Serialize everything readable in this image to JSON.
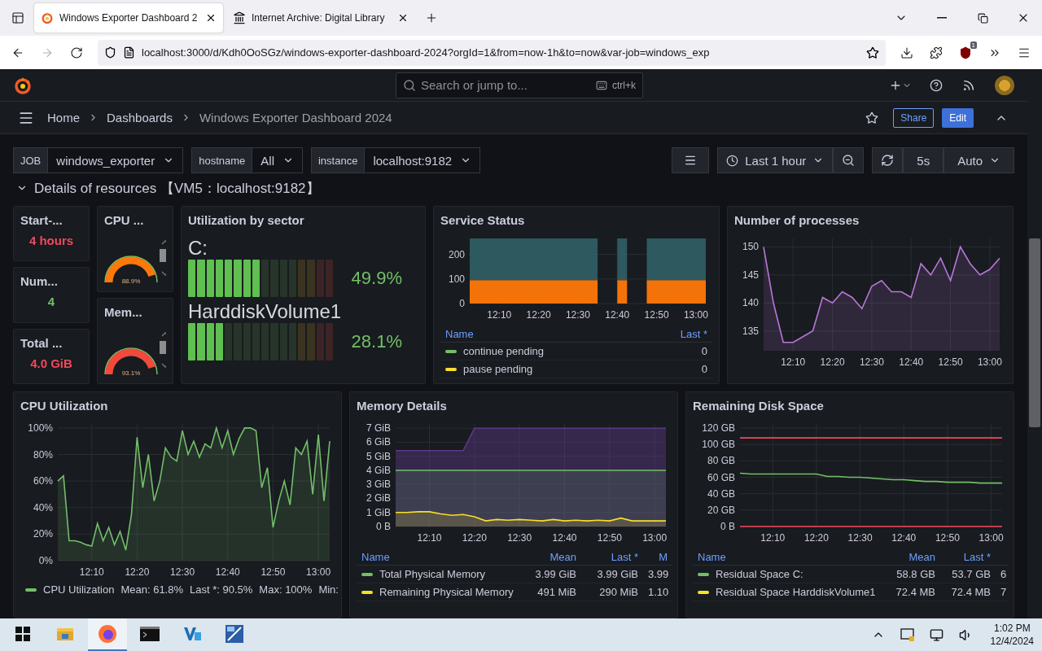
{
  "browser": {
    "tabs": [
      {
        "title": "Windows Exporter Dashboard 2",
        "kind": "grafana",
        "selected": true
      },
      {
        "title": "Internet Archive: Digital Library",
        "kind": "archive",
        "selected": false
      }
    ],
    "forward_enabled": false,
    "url": "localhost:3000/d/Kdh0OoSGz/windows-exporter-dashboard-2024?orgId=1&from=now-1h&to=now&var-job=windows_exp",
    "extension_badge": "1"
  },
  "grafana": {
    "search": {
      "placeholder": "Search or jump to...",
      "shortcut": "ctrl+k"
    },
    "breadcrumbs": [
      "Home",
      "Dashboards",
      "Windows Exporter Dashboard 2024"
    ],
    "share": "Share",
    "edit": "Edit",
    "variables": [
      {
        "label": "JOB",
        "value": "windows_exporter"
      },
      {
        "label": "hostname",
        "value": "All"
      },
      {
        "label": "instance",
        "value": "localhost:9182"
      }
    ],
    "time_range": "Last 1 hour",
    "refresh_interval": "5s",
    "refresh_mode": "Auto",
    "row": {
      "title": "Details of resources 【VM5：localhost:9182】",
      "expanded": true
    }
  },
  "stats": [
    {
      "title": "Start-...",
      "value": "4 hours",
      "color": "#f2495c"
    },
    {
      "title": "Num...",
      "value": "4",
      "color": "#73bf69"
    },
    {
      "title": "Total ...",
      "value": "4.0 GiB",
      "color": "#f2495c"
    }
  ],
  "gauges": [
    {
      "title": "CPU ...",
      "value": "88.9%",
      "color": "#ff780a"
    },
    {
      "title": "Mem...",
      "value": "93.1%",
      "color": "#f2493c"
    }
  ],
  "sectors": {
    "title": "Utilization by sector",
    "disks": [
      {
        "name": "C:",
        "value": "49.9%",
        "level": 0.499
      },
      {
        "name": "HarddiskVolume1",
        "value": "28.1%",
        "level": 0.281
      }
    ]
  },
  "service": {
    "title": "Service Status",
    "chart_data": {
      "type": "area",
      "stacked": true,
      "grid": true,
      "categories": [
        null,
        null,
        null,
        "12:10",
        null,
        null,
        null,
        "12:20",
        null,
        null,
        null,
        "12:30",
        null,
        null,
        null,
        "12:40",
        null,
        null,
        null,
        "12:50",
        null,
        null,
        null,
        "13:00",
        null
      ],
      "ylim": [
        0,
        265
      ],
      "yticks": [
        0,
        100,
        200
      ],
      "series": [
        {
          "color": "#ff780a",
          "values": [
            95,
            95,
            95,
            95,
            95,
            95,
            95,
            95,
            95,
            95,
            95,
            95,
            95,
            95,
            null,
            95,
            95,
            null,
            95,
            95,
            95,
            95,
            95,
            95,
            95
          ]
        },
        {
          "color": "#2f5d62",
          "values": [
            170,
            170,
            170,
            170,
            170,
            170,
            170,
            170,
            170,
            170,
            170,
            170,
            170,
            170,
            null,
            170,
            170,
            null,
            170,
            170,
            170,
            170,
            170,
            170,
            170
          ]
        }
      ]
    },
    "legend": {
      "columns": [
        "Name",
        "Last *"
      ],
      "rows": [
        {
          "name": "continue pending",
          "color": "#73bf69",
          "values": [
            "0"
          ]
        },
        {
          "name": "pause pending",
          "color": "#fade2a",
          "values": [
            "0"
          ]
        }
      ]
    }
  },
  "processes": {
    "title": "Number of processes",
    "chart_data": {
      "type": "area",
      "grid": true,
      "categories": [
        null,
        null,
        null,
        "12:10",
        null,
        null,
        null,
        "12:20",
        null,
        null,
        null,
        "12:30",
        null,
        null,
        null,
        "12:40",
        null,
        null,
        null,
        "12:50",
        null,
        null,
        null,
        "13:00",
        null
      ],
      "ylim": [
        131.5,
        151.5
      ],
      "yticks": [
        135,
        140,
        145,
        150
      ],
      "series": [
        {
          "color": "#b877d9",
          "values": [
            150,
            140,
            133,
            133,
            134,
            135,
            141,
            140,
            142,
            141,
            139,
            143,
            144,
            142,
            142,
            141,
            147,
            145,
            148,
            144,
            150,
            147,
            145,
            146,
            148
          ]
        }
      ]
    }
  },
  "cpu": {
    "title": "CPU Utilization",
    "chart_data": {
      "type": "area",
      "grid": true,
      "categories": [
        null,
        null,
        null,
        null,
        null,
        null,
        "12:10",
        null,
        null,
        null,
        null,
        null,
        null,
        null,
        "12:20",
        null,
        null,
        null,
        null,
        null,
        null,
        null,
        "12:30",
        null,
        null,
        null,
        null,
        null,
        null,
        null,
        "12:40",
        null,
        null,
        null,
        null,
        null,
        null,
        null,
        "12:50",
        null,
        null,
        null,
        null,
        null,
        null,
        null,
        "13:00",
        null,
        null
      ],
      "ylim": [
        0,
        103
      ],
      "yticks": [
        {
          "value": 0,
          "label": "0%"
        },
        {
          "value": 20,
          "label": "20%"
        },
        {
          "value": 40,
          "label": "40%"
        },
        {
          "value": 60,
          "label": "60%"
        },
        {
          "value": 80,
          "label": "80%"
        },
        {
          "value": 100,
          "label": "100%"
        }
      ],
      "series": [
        {
          "color": "#73bf69",
          "values": [
            60,
            64,
            15,
            15,
            14,
            12,
            11,
            28,
            15,
            25,
            12,
            22,
            8,
            35,
            93,
            55,
            80,
            45,
            60,
            85,
            78,
            75,
            98,
            80,
            90,
            78,
            88,
            85,
            100,
            85,
            98,
            80,
            92,
            100,
            100,
            98,
            55,
            70,
            25,
            45,
            60,
            42,
            85,
            80,
            90,
            50,
            95,
            45,
            90
          ]
        }
      ]
    },
    "legend": {
      "name": "CPU Utilization",
      "color": "#73bf69",
      "stats": [
        "Mean: 61.8%",
        "Last *: 90.5%",
        "Max: 100%",
        "Min:"
      ]
    }
  },
  "memory": {
    "title": "Memory Details",
    "chart_data": {
      "type": "area",
      "grid": true,
      "categories": [
        null,
        null,
        null,
        "12:10",
        null,
        null,
        null,
        "12:20",
        null,
        null,
        null,
        "12:30",
        null,
        null,
        null,
        "12:40",
        null,
        null,
        null,
        "12:50",
        null,
        null,
        null,
        "13:00",
        null
      ],
      "ylim": [
        0,
        7.3
      ],
      "yticks": [
        {
          "value": 0,
          "label": "0 B"
        },
        {
          "value": 1,
          "label": "1 GiB"
        },
        {
          "value": 2,
          "label": "2 GiB"
        },
        {
          "value": 3,
          "label": "3 GiB"
        },
        {
          "value": 4,
          "label": "4 GiB"
        },
        {
          "value": 5,
          "label": "5 GiB"
        },
        {
          "value": 6,
          "label": "6 GiB"
        },
        {
          "value": 7,
          "label": "7 GiB"
        }
      ],
      "series": [
        {
          "color": "#5b3a85",
          "values": [
            5.4,
            5.4,
            5.4,
            5.4,
            5.4,
            5.4,
            5.4,
            7,
            7,
            7,
            7,
            7,
            7,
            7,
            7,
            7,
            7,
            7,
            7,
            7,
            7,
            7,
            7,
            7,
            7
          ]
        },
        {
          "color": "#73bf69",
          "values": [
            4,
            4,
            4,
            4,
            4,
            4,
            4,
            4,
            4,
            4,
            4,
            4,
            4,
            4,
            4,
            4,
            4,
            4,
            4,
            4,
            4,
            4,
            4,
            4,
            4
          ]
        },
        {
          "color": "#fade2a",
          "values": [
            1.0,
            1.0,
            1.05,
            1.05,
            0.9,
            0.8,
            0.85,
            0.7,
            0.4,
            0.5,
            0.45,
            0.5,
            0.45,
            0.4,
            0.5,
            0.4,
            0.45,
            0.4,
            0.45,
            0.4,
            0.6,
            0.4,
            0.4,
            0.4,
            0.4
          ]
        }
      ]
    },
    "legend": {
      "columns": [
        "Name",
        "Mean",
        "Last *",
        "M"
      ],
      "rows": [
        {
          "name": "Total Physical Memory",
          "color": "#73bf69",
          "values": [
            "3.99 GiB",
            "3.99 GiB",
            "3.99"
          ]
        },
        {
          "name": "Remaining Physical Memory",
          "color": "#fade2a",
          "values": [
            "491 MiB",
            "290 MiB",
            "1.10"
          ]
        }
      ]
    }
  },
  "disk": {
    "title": "Remaining Disk Space",
    "chart_data": {
      "type": "line",
      "grid": true,
      "categories": [
        null,
        null,
        null,
        "12:10",
        null,
        null,
        null,
        "12:20",
        null,
        null,
        null,
        "12:30",
        null,
        null,
        null,
        "12:40",
        null,
        null,
        null,
        "12:50",
        null,
        null,
        null,
        "13:00",
        null
      ],
      "ylim": [
        0,
        125
      ],
      "yticks": [
        {
          "value": 0,
          "label": "0 B"
        },
        {
          "value": 20,
          "label": "20 GB"
        },
        {
          "value": 40,
          "label": "40 GB"
        },
        {
          "value": 60,
          "label": "60 GB"
        },
        {
          "value": 80,
          "label": "80 GB"
        },
        {
          "value": 100,
          "label": "100 GB"
        },
        {
          "value": 120,
          "label": "120 GB"
        }
      ],
      "series": [
        {
          "color": "#f2495c",
          "values": [
            108,
            108,
            108,
            108,
            108,
            108,
            108,
            108,
            108,
            108,
            108,
            108,
            108,
            108,
            108,
            108,
            108,
            108,
            108,
            108,
            108,
            108,
            108,
            108,
            108
          ]
        },
        {
          "color": "#73bf69",
          "values": [
            65,
            64,
            64,
            64,
            64,
            64,
            64,
            64,
            61,
            61,
            60,
            60,
            59,
            58,
            57,
            57,
            56,
            55,
            55,
            54,
            54,
            54,
            53,
            53,
            53
          ]
        },
        {
          "color": "#f2495c",
          "values": [
            0,
            0,
            0,
            0,
            0,
            0,
            0,
            0,
            0,
            0,
            0,
            0,
            0,
            0,
            0,
            0,
            0,
            0,
            0,
            0,
            0,
            0,
            0,
            0,
            0
          ]
        }
      ]
    },
    "legend": {
      "columns": [
        "Name",
        "Mean",
        "Last *"
      ],
      "rows": [
        {
          "name": "Residual Space C:",
          "color": "#73bf69",
          "values": [
            "58.8 GB",
            "53.7 GB",
            "6"
          ]
        },
        {
          "name": "Residual Space HarddiskVolume1",
          "color": "#fade2a",
          "values": [
            "72.4 MB",
            "72.4 MB",
            "7"
          ]
        }
      ]
    }
  },
  "taskbar": {
    "time": "1:02 PM",
    "date": "12/4/2024"
  }
}
